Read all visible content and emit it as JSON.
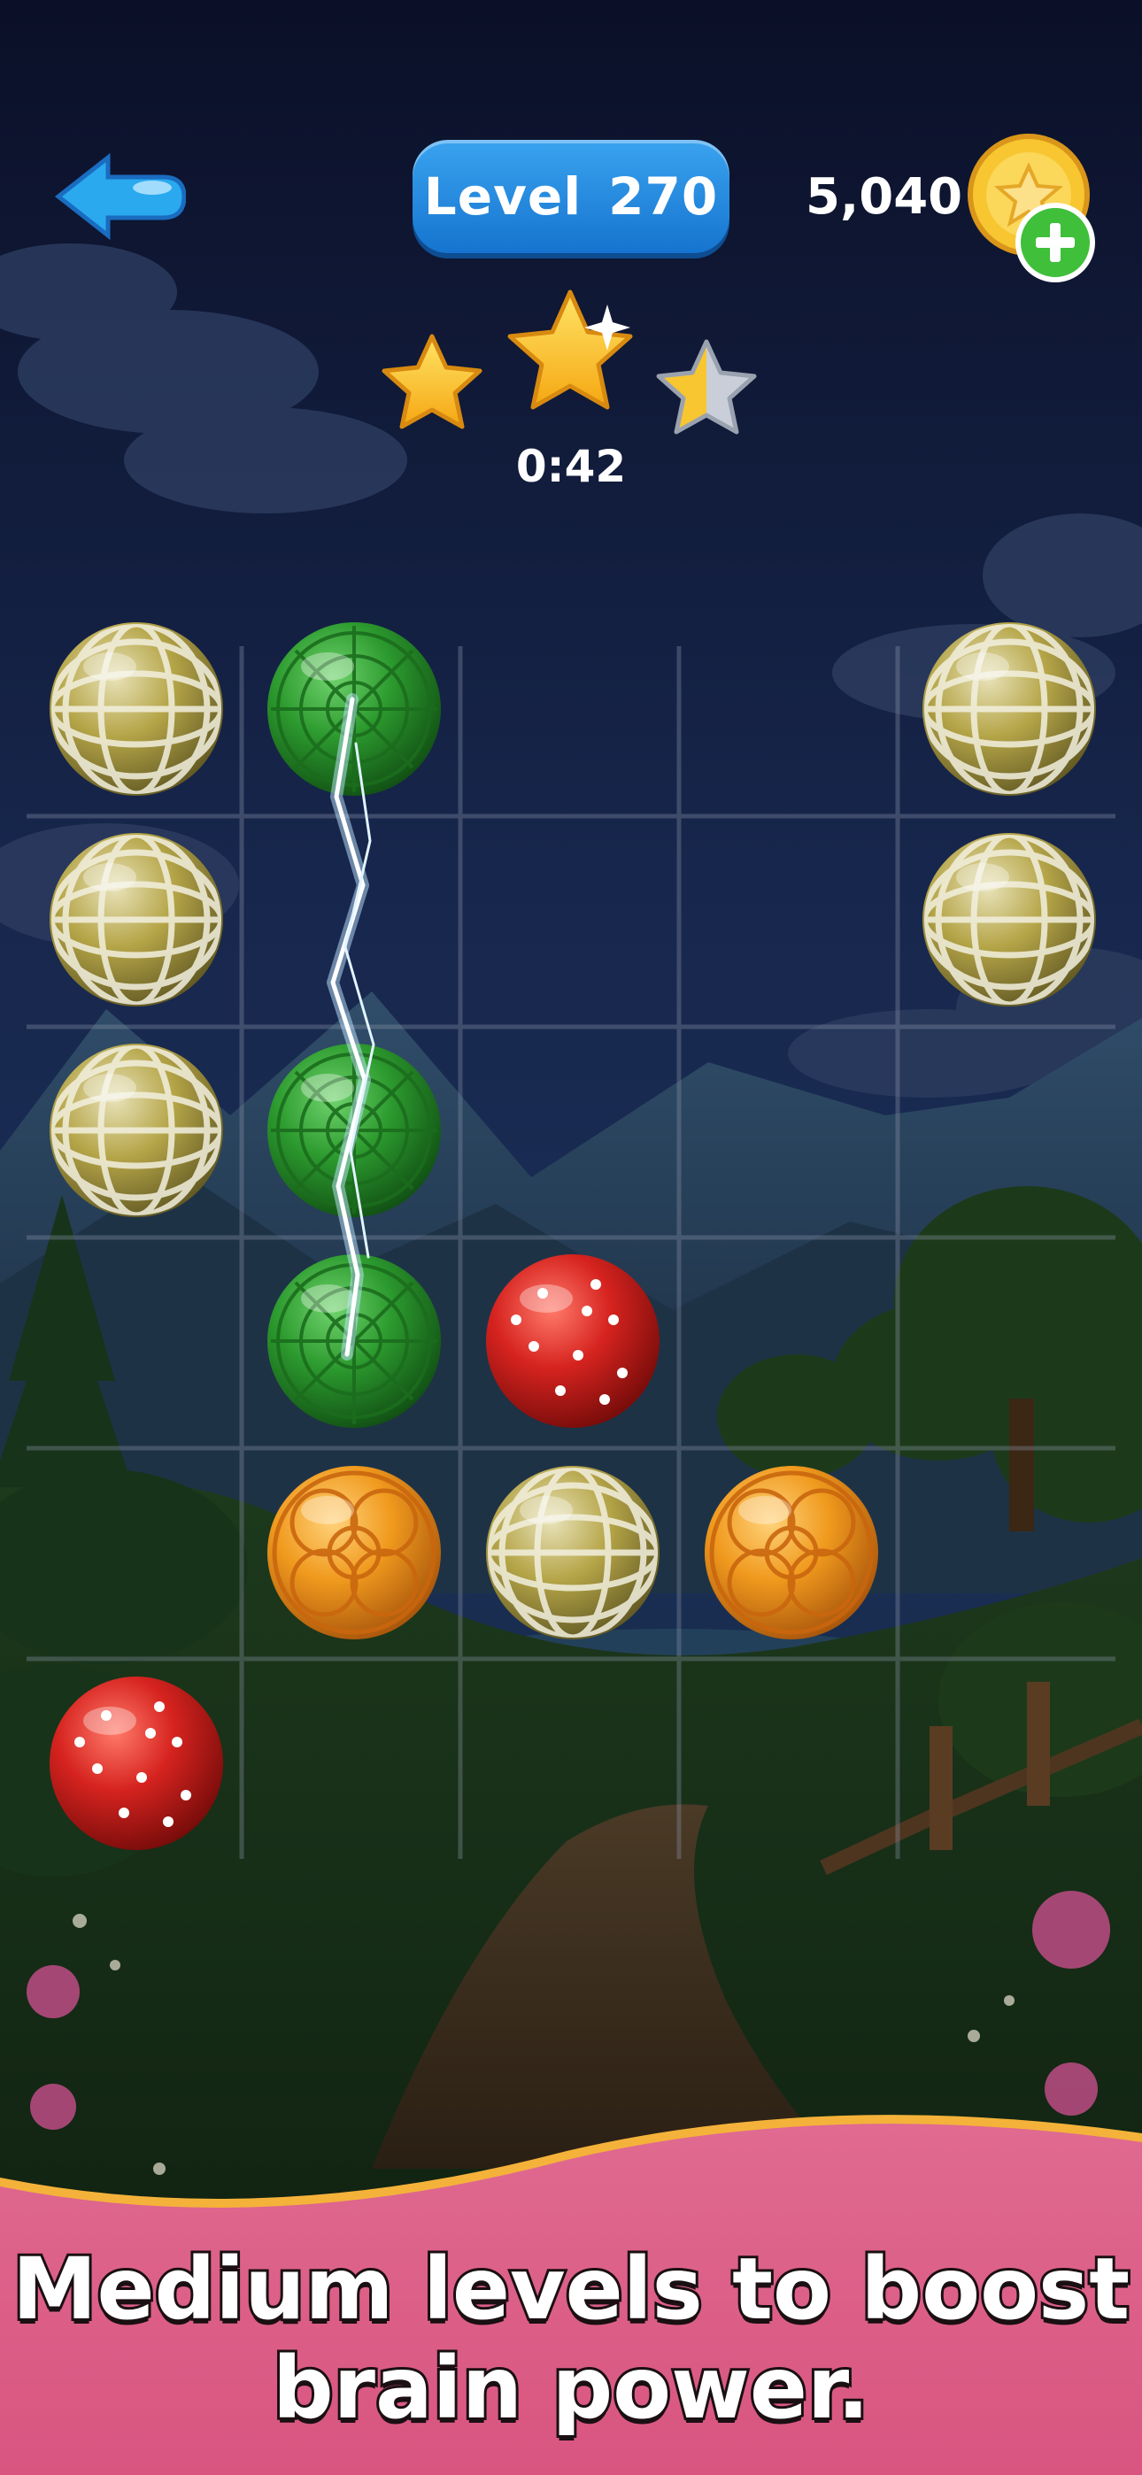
{
  "header": {
    "level_label": "Level",
    "level_number": "270",
    "coins": "5,040"
  },
  "progress": {
    "stars_earned": 2.5,
    "stars_total": 3,
    "timer": "0:42"
  },
  "board": {
    "columns": 5,
    "rows": 6,
    "balls": [
      {
        "col": 0,
        "row": 0,
        "color": "gold-white"
      },
      {
        "col": 1,
        "row": 0,
        "color": "green"
      },
      {
        "col": 4,
        "row": 0,
        "color": "gold-white"
      },
      {
        "col": 0,
        "row": 1,
        "color": "gold-white"
      },
      {
        "col": 4,
        "row": 1,
        "color": "gold-white"
      },
      {
        "col": 0,
        "row": 2,
        "color": "gold-white"
      },
      {
        "col": 1,
        "row": 2,
        "color": "green"
      },
      {
        "col": 1,
        "row": 3,
        "color": "green"
      },
      {
        "col": 2,
        "row": 3,
        "color": "red"
      },
      {
        "col": 1,
        "row": 4,
        "color": "orange"
      },
      {
        "col": 2,
        "row": 4,
        "color": "gold-white"
      },
      {
        "col": 3,
        "row": 4,
        "color": "orange"
      },
      {
        "col": 0,
        "row": 5,
        "color": "red"
      }
    ]
  },
  "banner": {
    "line1": "Medium levels to boost",
    "line2": "brain power."
  },
  "colors": {
    "accent": "#1f86e0",
    "banner": "#e06a90",
    "coin": "#f7c630",
    "plus": "#3fbf3a"
  }
}
